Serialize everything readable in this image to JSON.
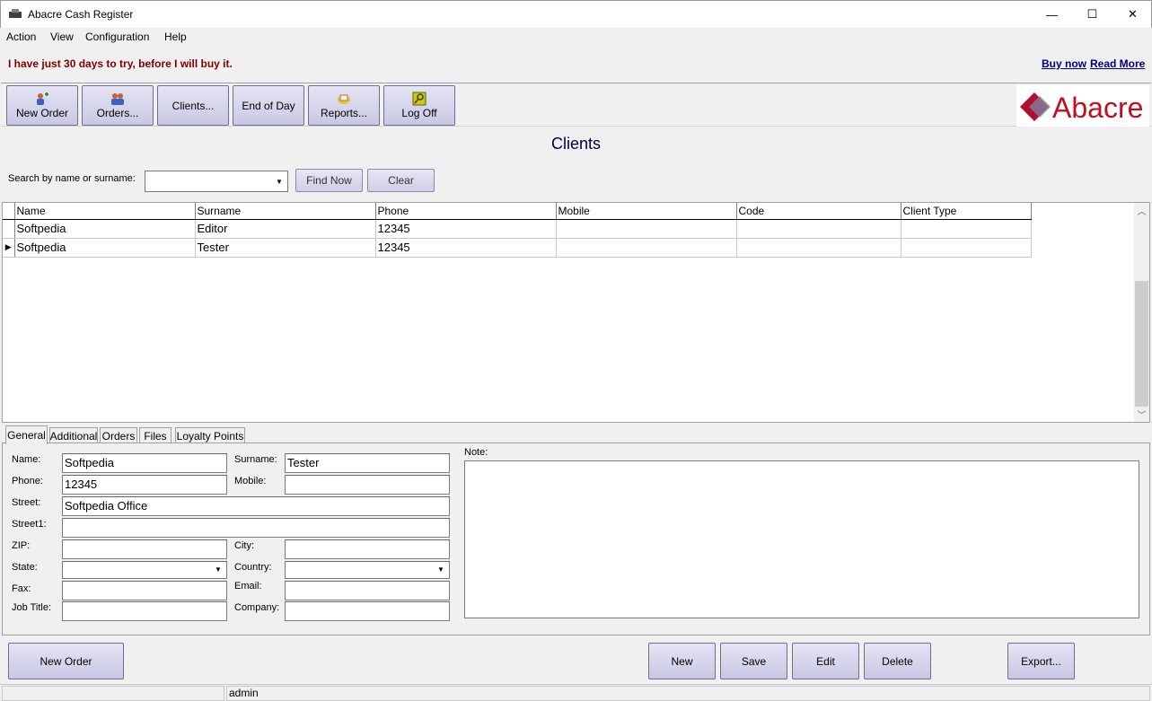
{
  "window": {
    "title": "Abacre Cash Register",
    "minimize": "—",
    "maximize": "☐",
    "close": "✕"
  },
  "menu": [
    "Action",
    "View",
    "Configuration",
    "Help"
  ],
  "banner": {
    "message": "I have just 30 days to try, before I will buy it.",
    "buy_now": "Buy now",
    "read_more": "Read More"
  },
  "toolbar": [
    {
      "label": "New Order",
      "icon": "new-order-icon"
    },
    {
      "label": "Orders...",
      "icon": "orders-icon"
    },
    {
      "label": "Clients...",
      "icon": ""
    },
    {
      "label": "End of Day",
      "icon": ""
    },
    {
      "label": "Reports...",
      "icon": "reports-icon"
    },
    {
      "label": "Log Off",
      "icon": "key-icon"
    }
  ],
  "logo_text": "Abacre",
  "page_title": "Clients",
  "search": {
    "label": "Search by name or surname:",
    "value": "",
    "find_now": "Find Now",
    "clear": "Clear"
  },
  "grid": {
    "columns": [
      "Name",
      "Surname",
      "Phone",
      "Mobile",
      "Code",
      "Client Type"
    ],
    "rows": [
      {
        "name": "Softpedia",
        "surname": "Editor",
        "phone": "12345",
        "mobile": "",
        "code": "",
        "client_type": ""
      },
      {
        "name": "Softpedia",
        "surname": "Tester",
        "phone": "12345",
        "mobile": "",
        "code": "",
        "client_type": ""
      }
    ],
    "selected_row": 1
  },
  "tabs": [
    "General",
    "Additional",
    "Orders",
    "Files",
    "Loyalty Points"
  ],
  "form": {
    "name_label": "Name:",
    "name": "Softpedia",
    "surname_label": "Surname:",
    "surname": "Tester",
    "phone_label": "Phone:",
    "phone": "12345",
    "mobile_label": "Mobile:",
    "mobile": "",
    "street_label": "Street:",
    "street": "Softpedia Office",
    "street1_label": "Street1:",
    "street1": "",
    "zip_label": "ZIP:",
    "zip": "",
    "city_label": "City:",
    "city": "",
    "state_label": "State:",
    "state": "",
    "country_label": "Country:",
    "country": "",
    "fax_label": "Fax:",
    "fax": "",
    "email_label": "Email:",
    "email": "",
    "jobtitle_label": "Job Title:",
    "jobtitle": "",
    "company_label": "Company:",
    "company": "",
    "note_label": "Note:",
    "note": ""
  },
  "buttons": {
    "new_order": "New Order",
    "new": "New",
    "save": "Save",
    "edit": "Edit",
    "delete": "Delete",
    "export": "Export..."
  },
  "status": {
    "user": "admin"
  }
}
